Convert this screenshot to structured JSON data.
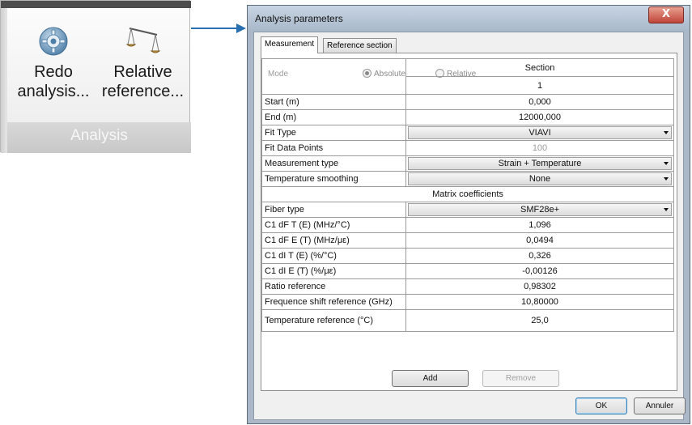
{
  "ribbon": {
    "buttons": [
      {
        "line1": "Redo",
        "line2": "analysis...",
        "icon": "gear-refresh-icon"
      },
      {
        "line1": "Relative",
        "line2": "reference...",
        "icon": "balance-scale-icon"
      }
    ],
    "group_label": "Analysis"
  },
  "dialog": {
    "title": "Analysis parameters",
    "close_glyph": "X",
    "tabs": [
      {
        "label": "Measurement",
        "active": true
      },
      {
        "label": "Reference section",
        "active": false
      }
    ],
    "mode": {
      "label": "Mode",
      "options": [
        {
          "label": "Absolute",
          "selected": true
        },
        {
          "label": "Relative",
          "selected": false
        }
      ]
    },
    "table": {
      "header": "Section",
      "section_number": "1",
      "rows": [
        {
          "label": "Start (m)",
          "value": "0,000"
        },
        {
          "label": "End (m)",
          "value": "12000,000"
        },
        {
          "label": "Fit Type",
          "value": "VIAVI"
        },
        {
          "label": "Fit Data Points",
          "value": "100"
        },
        {
          "label": "Measurement type",
          "value": "Strain + Temperature"
        },
        {
          "label": "Temperature smoothing",
          "value": "None"
        }
      ],
      "matrix_header": "Matrix coefficients",
      "matrix_rows": [
        {
          "label": "Fiber type",
          "value": "SMF28e+"
        },
        {
          "label": "C1 dF T (E) (MHz/°C)",
          "value": "1,096"
        },
        {
          "label": "C1 dF E (T) (MHz/με)",
          "value": "0,0494"
        },
        {
          "label": "C1 dI T (E) (%/°C)",
          "value": "0,326"
        },
        {
          "label": "C1 dI E (T) (%/με)",
          "value": "-0,00126"
        },
        {
          "label": "Ratio reference",
          "value": "0,98302"
        },
        {
          "label": "Frequence shift reference (GHz)",
          "value": "10,80000"
        },
        {
          "label": "Temperature reference (°C)",
          "value": "25,0"
        }
      ]
    },
    "buttons": {
      "add": "Add",
      "remove": "Remove",
      "ok": "OK",
      "cancel": "Annuler"
    }
  },
  "colors": {
    "accent_arrow": "#2a6fb0",
    "title_bar": "#b8c6d6",
    "close_button": "#c7463a"
  }
}
